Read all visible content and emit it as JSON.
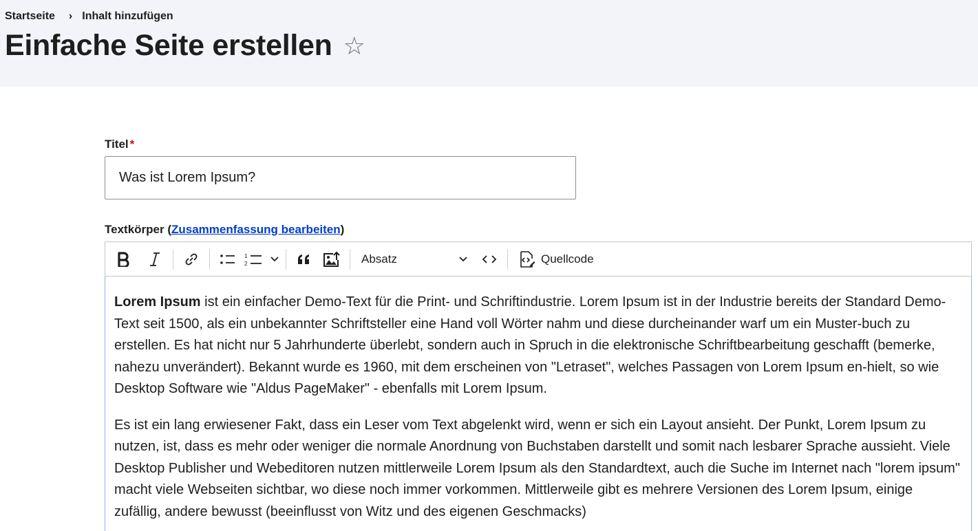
{
  "breadcrumb": {
    "home": "Startseite",
    "separator": "›",
    "current": "Inhalt hinzufügen"
  },
  "page": {
    "title": "Einfache Seite erstellen",
    "star_icon": "☆"
  },
  "form": {
    "title_label": "Titel",
    "required_mark": "*",
    "title_value": "Was ist Lorem Ipsum?",
    "body_label": "Textkörper",
    "body_label_open": " (",
    "summary_link": "Zusammenfassung bearbeiten",
    "body_label_close": ")"
  },
  "toolbar": {
    "icons": [
      "bold-icon",
      "italic-icon",
      "link-icon",
      "bulleted-list-icon",
      "numbered-list-icon",
      "blockquote-icon",
      "image-upload-icon",
      "code-icon",
      "source-icon"
    ],
    "heading_value": "Absatz",
    "source_label": "Quellcode"
  },
  "editor": {
    "p1_bold": "Lorem Ipsum",
    "p1_rest": " ist ein einfacher Demo-Text für die Print- und Schriftindustrie. Lorem Ipsum ist in der Industrie bereits der Standard Demo-Text seit 1500, als ein unbekannter Schriftsteller eine Hand voll Wörter nahm und diese durcheinander warf um ein Muster-buch zu erstellen. Es hat nicht nur 5 Jahrhunderte überlebt, sondern auch in Spruch in die elektronische Schriftbearbeitung geschafft (bemerke, nahezu unverändert). Bekannt wurde es 1960, mit dem erscheinen von \"Letraset\", welches Passagen von Lorem Ipsum en-hielt, so wie Desktop Software wie \"Aldus PageMaker\" - ebenfalls mit Lorem Ipsum.",
    "p2": "Es ist ein lang erwiesener Fakt, dass ein Leser vom Text abgelenkt wird, wenn er sich ein Layout ansieht. Der Punkt, Lorem Ipsum zu nutzen, ist, dass es mehr oder weniger die normale Anordnung von Buchstaben darstellt und somit nach lesbarer Sprache aussieht. Viele Desktop Publisher und Webeditoren nutzen mittlerweile Lorem Ipsum als den Standardtext, auch die Suche im Internet nach \"lorem ipsum\" macht viele Webseiten sichtbar, wo diese noch immer vorkommen. Mittlerweile gibt es mehrere Versionen des Lorem Ipsum, einige zufällig, andere bewusst (beeinflusst von Witz und des eigenen Geschmacks)"
  },
  "colors": {
    "header_bg": "#f3f4f9",
    "link": "#003ecc",
    "required": "#cc1111",
    "editor_focus_border": "#8ab4f8"
  }
}
